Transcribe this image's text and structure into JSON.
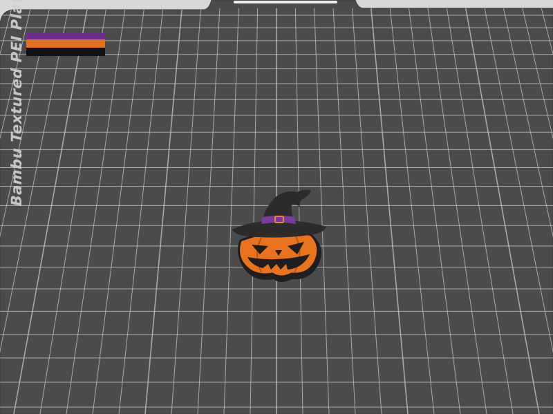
{
  "plate": {
    "label": "Bambu Textured PEI Plate",
    "surface_color": "#4a4b4c",
    "grid_color": "#c9c9c9",
    "background_color": "#d8d8d8"
  },
  "filament_swatch": {
    "colors": [
      "#6a2e8f",
      "#e0731c",
      "#111111"
    ]
  },
  "model": {
    "name": "pumpkin-witch-hat",
    "colors": {
      "hat": "#2b2b2b",
      "band": "#7b3aa0",
      "buckle": "#e88a23",
      "pumpkin": "#e9731d",
      "outline": "#1e1e1e"
    }
  }
}
